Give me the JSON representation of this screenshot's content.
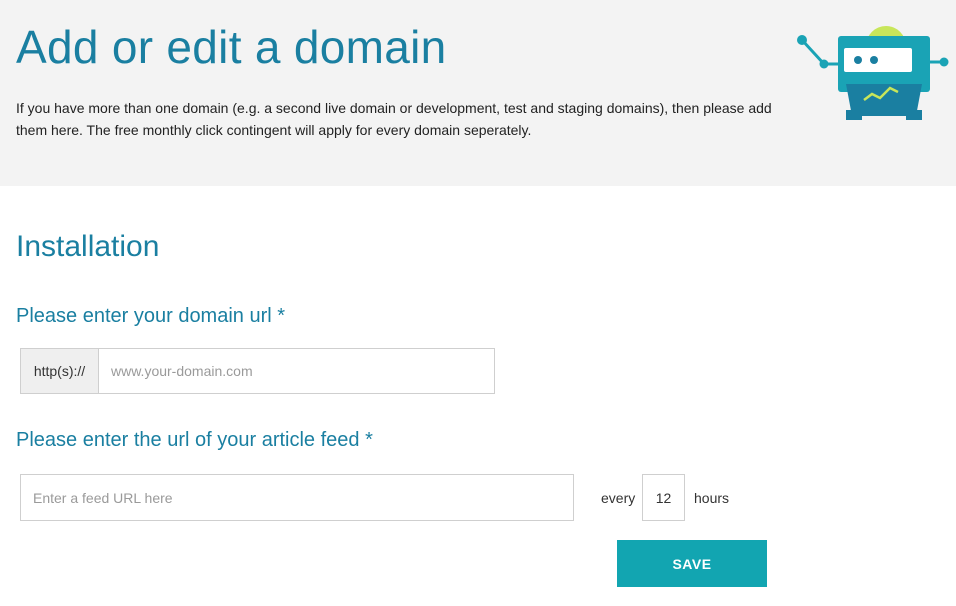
{
  "header": {
    "title": "Add or edit a domain",
    "description": "If you have more than one domain (e.g. a second live domain or development, test and staging domains), then please add them here. The free monthly click contingent will apply for every domain seperately.",
    "illustration_icon": "robot-icon"
  },
  "installation": {
    "section_title": "Installation",
    "domain": {
      "label": "Please enter your domain url *",
      "prefix": "http(s)://",
      "placeholder": "www.your-domain.com",
      "value": ""
    },
    "feed": {
      "label": "Please enter the url of your article feed *",
      "placeholder": "Enter a feed URL here",
      "value": "",
      "every_label": "every",
      "hours_value": "12",
      "hours_label": "hours"
    },
    "save_label": "SAVE"
  },
  "colors": {
    "accent": "#1a7fa1",
    "button": "#12a5b1",
    "header_bg": "#f3f3f3",
    "robot_lime": "#c8e65a"
  }
}
